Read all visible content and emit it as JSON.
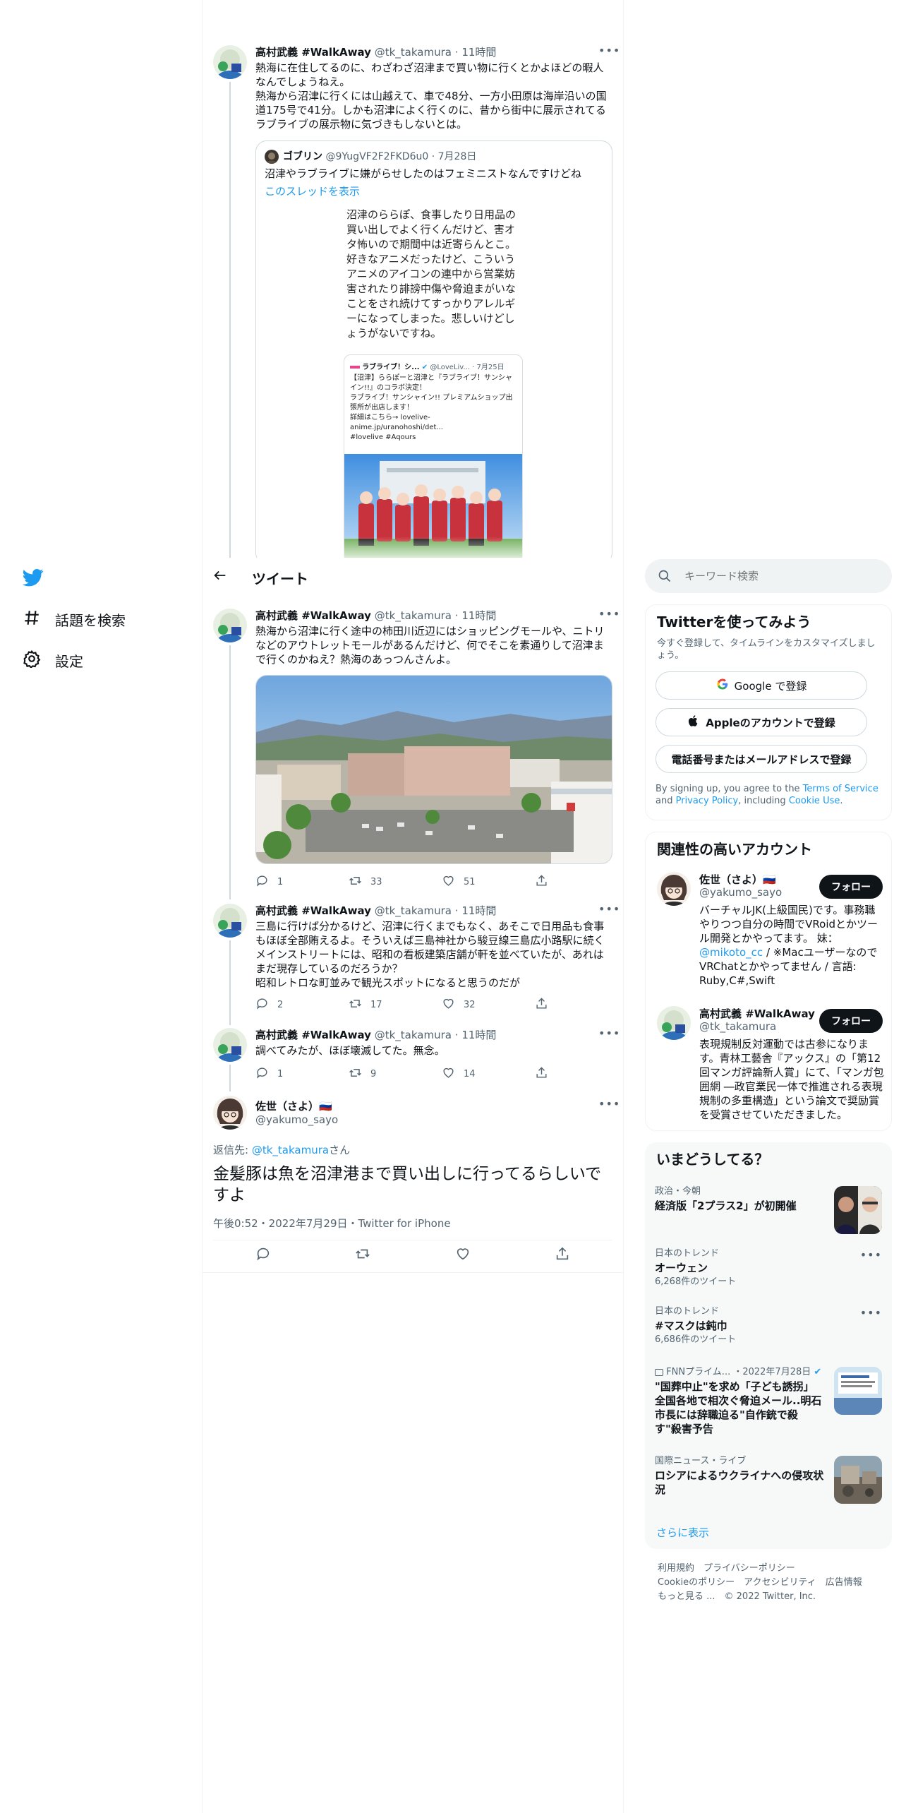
{
  "nav": {
    "explore": "話題を検索",
    "settings": "設定"
  },
  "header": {
    "title": "ツイート"
  },
  "search": {
    "placeholder": "キーワード検索"
  },
  "tweets": [
    {
      "name": "高村武義 #WalkAway",
      "handle": "@tk_takamura",
      "time": "11時間",
      "text": "熱海に在住してるのに、わざわざ沼津まで買い物に行くとかよほどの暇人なんでしょうねえ。\n熱海から沼津に行くには山越えて、車で48分、一方小田原は海岸沿いの国道175号で41分。しかも沼津によく行くのに、昔から街中に展示されてるラブライブの展示物に気づきもしないとは。",
      "quote": {
        "name": "ゴブリン",
        "handle": "@9YugVF2F2FKD6u0",
        "date": "7月28日",
        "text": "沼津やラブライブに嫌がらせしたのはフェミニストなんですけどね",
        "show_thread": "このスレッドを表示",
        "image_text": "沼津のららぽ、食事したり日用品の買い出しでよく行くんだけど、害オタ怖いので期間中は近寄らんとこ。\n好きなアニメだったけど、こういうアニメのアイコンの連中から営業妨害されたり誹謗中傷や脅迫まがいなことをされ続けてすっかりアレルギーになってしまった。悲しいけどしょうがないですね。",
        "embed": {
          "name": "ラブライブ！シ...",
          "handle": "@LoveLiv...",
          "date": "7月25日",
          "text": "【沼津】ららぽーと沼津と『ラブライブ！サンシャイン!!』のコラボ決定！\nラブライブ！サンシャイン!! プレミアムショップ出張所が出店します！\n詳細はこちら→ lovelive-anime.jp/uranohoshi/det...\n#lovelive #Aqours"
        }
      }
    },
    {
      "name": "高村武義 #WalkAway",
      "handle": "@tk_takamura",
      "time": "11時間",
      "text": "熱海から沼津に行く途中の柿田川近辺にはショッピングモールや、ニトリなどのアウトレットモールがあるんだけど、何でそこを素通りして沼津まで行くのかねえ？熱海のあっつんさんよ。",
      "replies": "1",
      "retweets": "33",
      "likes": "51"
    },
    {
      "name": "高村武義 #WalkAway",
      "handle": "@tk_takamura",
      "time": "11時間",
      "text": "三島に行けば分かるけど、沼津に行くまでもなく、あそこで日用品も食事もほぼ全部賄えるよ。そういえば三島神社から駿豆線三島広小路駅に続くメインストリートには、昭和の看板建築店舗が軒を並べていたが、あれはまだ現存しているのだろうか？\n昭和レトロな町並みで観光スポットになると思うのだが",
      "replies": "2",
      "retweets": "17",
      "likes": "32"
    },
    {
      "name": "高村武義 #WalkAway",
      "handle": "@tk_takamura",
      "time": "11時間",
      "text": "調べてみたが、ほぼ壊滅してた。無念。",
      "replies": "1",
      "retweets": "9",
      "likes": "14"
    }
  ],
  "main_tweet": {
    "name": "佐世（さよ）🇷🇺",
    "handle": "@yakumo_sayo",
    "reply_prefix": "返信先: ",
    "reply_to": "@tk_takamura",
    "reply_suffix": "さん",
    "text": "金髪豚は魚を沼津港まで買い出しに行ってるらしいですよ",
    "meta": "午後0:52・2022年7月29日・Twitter for iPhone"
  },
  "signup": {
    "title": "Twitterを使ってみよう",
    "subtitle": "今すぐ登録して、タイムラインをカスタマイズしましょう。",
    "google": "Google で登録",
    "apple": "Appleのアカウントで登録",
    "phone": "電話番号またはメールアドレスで登録",
    "terms_1": "By signing up, you agree to the ",
    "terms_link1": "Terms of Service",
    "terms_2": " and ",
    "terms_link2": "Privacy Policy",
    "terms_3": ", including ",
    "terms_link3": "Cookie Use",
    "terms_4": "."
  },
  "relevant": {
    "title": "関連性の高いアカウント",
    "follow": "フォロー",
    "accounts": [
      {
        "name": "佐世（さよ）🇷🇺",
        "handle": "@yakumo_sayo",
        "bio_1": "バーチャルJK(上級国民)です。事務職やりつつ自分の時間でVRoidとかツール開発とかやってます。 妹：",
        "bio_link": "@mikoto_cc",
        "bio_2": " / ※MacユーザーなのでVRChatとかやってません / 言語: Ruby,C#,Swift"
      },
      {
        "name": "高村武義 #WalkAway",
        "handle": "@tk_takamura",
        "bio_1": "表現規制反対運動では古参になります。青林工藝舎『アックス』の「第12回マンガ評論新人賞」にて、「マンガ包囲網 ―政官業民一体で推進される表現規制の多重構造」という論文で奨励賞を受賞させていただきました。"
      }
    ]
  },
  "trends": {
    "title": "いまどうしてる？",
    "show_more": "さらに表示",
    "items": [
      {
        "context": "政治・今朝",
        "title": "経済版「2プラス2」が初開催"
      },
      {
        "context": "日本のトレンド",
        "title": "オーウェン",
        "count": "6,268件のツイート"
      },
      {
        "context": "日本のトレンド",
        "title": "#マスクは鈍巾",
        "count": "6,686件のツイート"
      },
      {
        "context": "FNNプライム... ・2022年7月28日",
        "title": "\"国葬中止\"を求め「子ども誘拐」全国各地で相次ぐ脅迫メール..明石市長には辞職迫る\"自作銃で殺す\"殺害予告"
      },
      {
        "context": "国際ニュース・ライブ",
        "title": "ロシアによるウクライナへの侵攻状況"
      }
    ]
  },
  "footer": {
    "line1": "利用規約　プライバシーポリシー",
    "line2": "Cookieのポリシー　アクセシビリティ　広告情報",
    "line3": "もっと見る ...　© 2022 Twitter, Inc."
  },
  "colors": {
    "accent": "#1d9bf0",
    "text": "#0f1419",
    "muted": "#536471"
  }
}
